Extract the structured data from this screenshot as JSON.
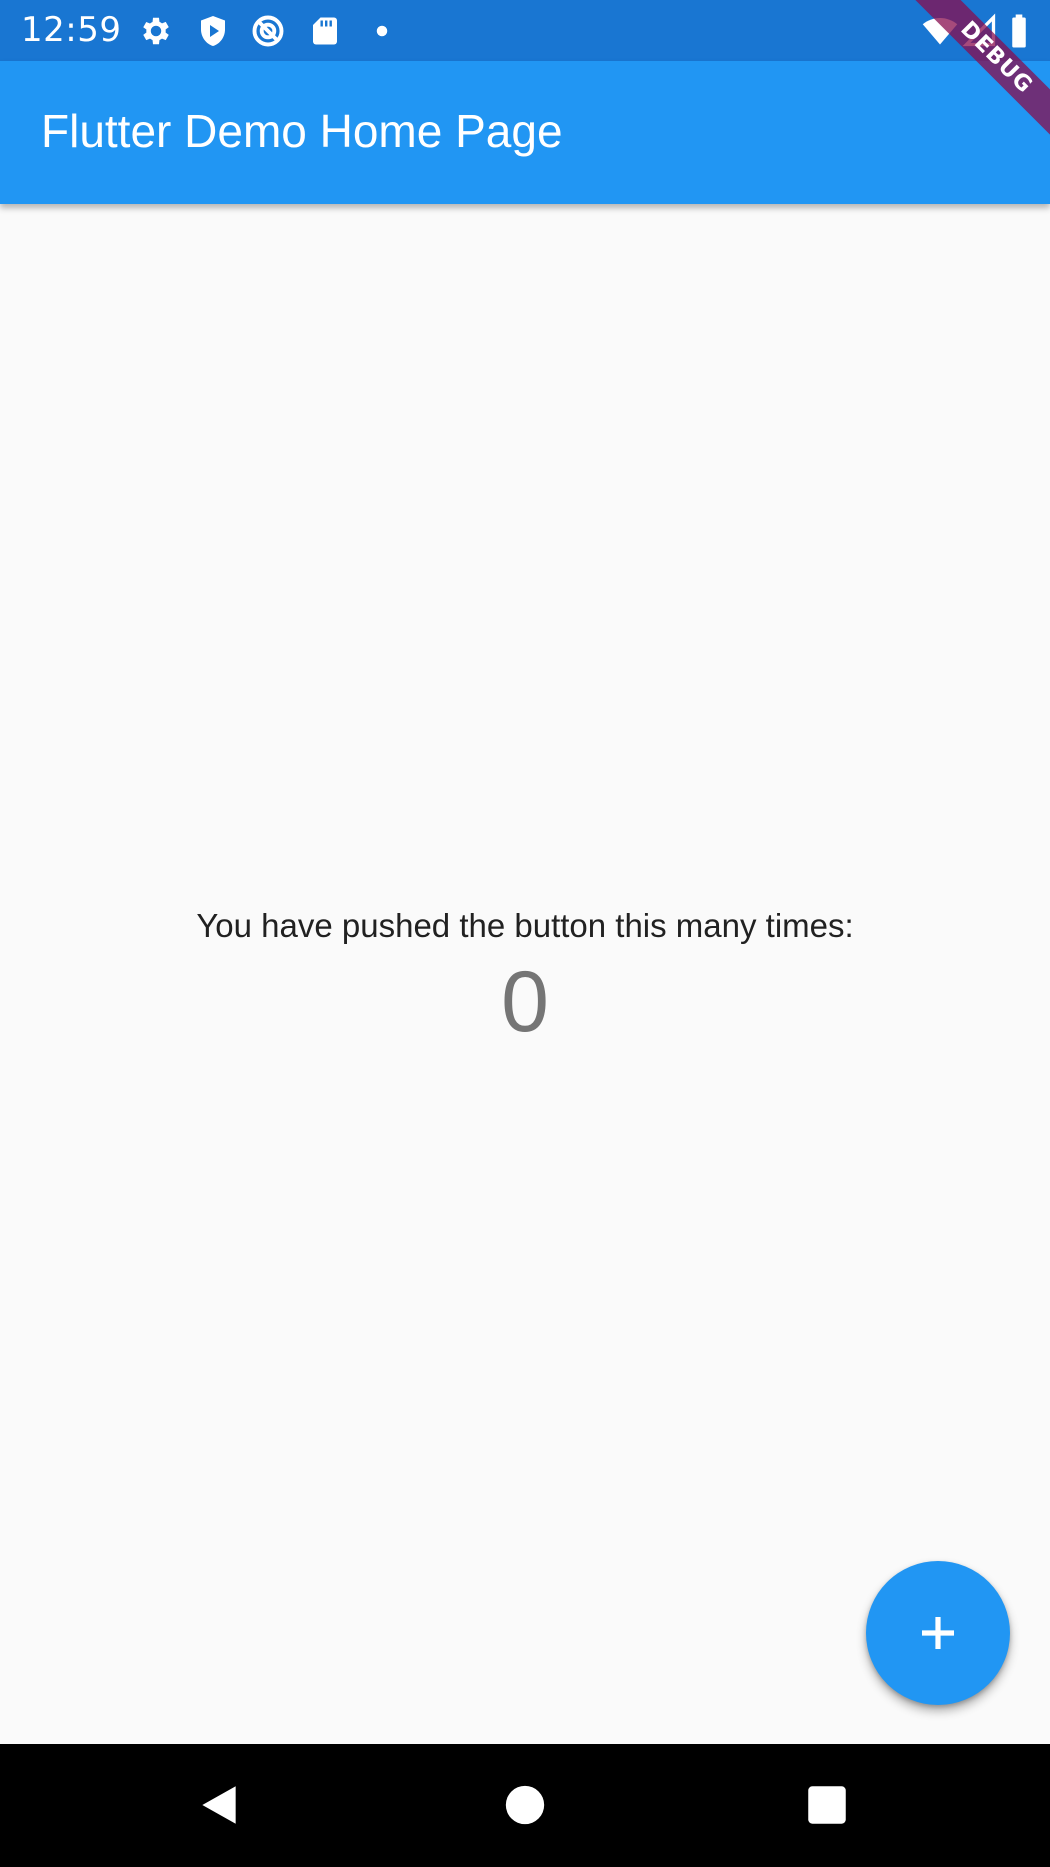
{
  "status_bar": {
    "time": "12:59",
    "icons": [
      "settings-icon",
      "shield-icon",
      "vpn-icon",
      "sd-card-icon",
      "dot-icon",
      "wifi-icon",
      "signal-icon",
      "battery-icon"
    ],
    "background_color": "#1976d2"
  },
  "app_bar": {
    "title": "Flutter Demo Home Page",
    "background_color": "#2196f3"
  },
  "debug_banner": {
    "label": "DEBUG"
  },
  "body": {
    "counter_label": "You have pushed the button this many times:",
    "counter_value": "0"
  },
  "fab": {
    "icon": "plus-icon",
    "color": "#2196f3"
  },
  "nav_bar": {
    "buttons": [
      "back-icon",
      "home-icon",
      "recents-icon"
    ]
  }
}
